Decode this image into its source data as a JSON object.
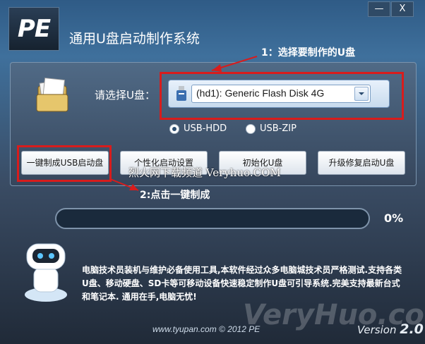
{
  "app": {
    "logo_text": "PE",
    "title": "通用U盘启动制作系统",
    "minimize_label": "—",
    "close_label": "X"
  },
  "annotations": {
    "step1": "1：选择要制作的U盘",
    "step2": "2:点击一键制成"
  },
  "selector": {
    "label": "请选择U盘：",
    "value": "(hd1): Generic Flash Disk 4G"
  },
  "modes": [
    {
      "label": "USB-HDD",
      "selected": true
    },
    {
      "label": "USB-ZIP",
      "selected": false
    }
  ],
  "buttons": {
    "make": "一键制成USB启动盘",
    "personalize": "个性化启动设置",
    "init": "初始化U盘",
    "upgrade": "升级修复启动U盘"
  },
  "watermark": "烈火网下载频道 Veryhuo.COM",
  "progress": {
    "value": 0,
    "label": "0%"
  },
  "description": "电脑技术员装机与维护必备使用工具,本软件经过众多电脑城技术员严格测试.支持各类U盘、移动硬盘、SD卡等可移动设备快速稳定制作U盘可引导系统.完美支持最新台式和笔记本. 通用在手,电脑无忧!",
  "footer": {
    "url": "www.tyupan.com © 2012 PE",
    "version_word": "Version",
    "version_number": "2.0"
  },
  "overlay_watermark": "VeryHuo.com",
  "colors": {
    "accent_red": "#d81c1c",
    "progress_blue": "#3b8de0",
    "background_dark": "#202a38"
  }
}
